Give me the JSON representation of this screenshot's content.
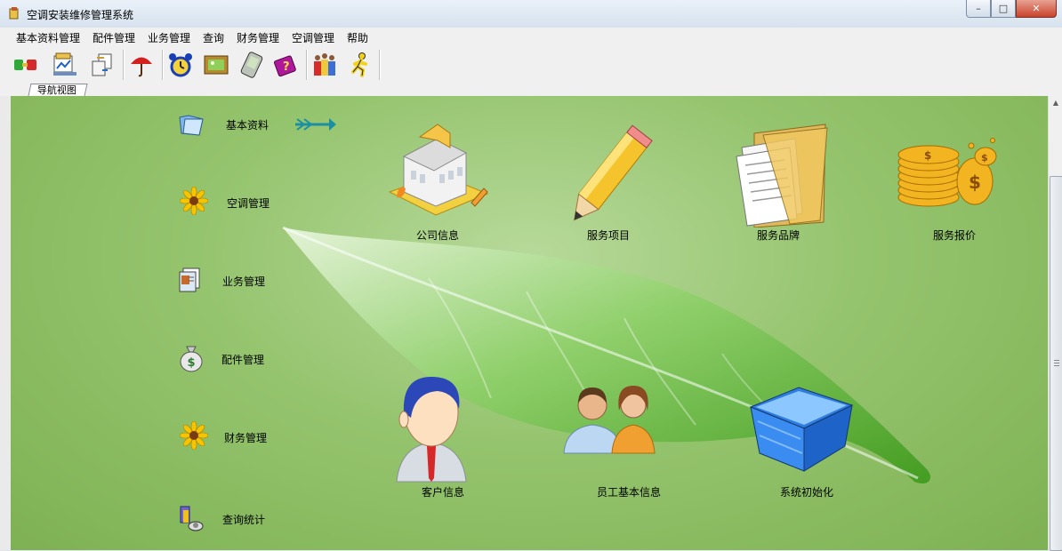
{
  "window": {
    "title": "空调安装维修管理系统"
  },
  "menubar": {
    "items": [
      "基本资料管理",
      "配件管理",
      "业务管理",
      "查询",
      "财务管理",
      "空调管理",
      "帮助"
    ]
  },
  "toolbar": {
    "icons": [
      "connection-icon",
      "document-chart-icon",
      "document-transfer-icon",
      "umbrella-icon",
      "alarm-clock-icon",
      "picture-frame-icon",
      "pda-icon",
      "help-book-icon",
      "gift-people-icon",
      "exit-runner-icon"
    ]
  },
  "tabs": {
    "nav_view": "导航视图"
  },
  "nav": {
    "items": [
      {
        "label": "基本资料",
        "icon": "folder-icon"
      },
      {
        "label": "空调管理",
        "icon": "flower-icon"
      },
      {
        "label": "业务管理",
        "icon": "documents-icon"
      },
      {
        "label": "配件管理",
        "icon": "money-bag-icon"
      },
      {
        "label": "财务管理",
        "icon": "flower-icon"
      },
      {
        "label": "查询统计",
        "icon": "search-tools-icon"
      }
    ]
  },
  "tiles": {
    "items": [
      {
        "label": "公司信息",
        "icon": "building-icon"
      },
      {
        "label": "服务项目",
        "icon": "pencil-icon"
      },
      {
        "label": "服务品牌",
        "icon": "folder-documents-icon"
      },
      {
        "label": "服务报价",
        "icon": "coins-icon"
      },
      {
        "label": "客户信息",
        "icon": "user-icon"
      },
      {
        "label": "员工基本信息",
        "icon": "users-icon"
      },
      {
        "label": "系统初始化",
        "icon": "blue-basket-icon"
      }
    ]
  }
}
